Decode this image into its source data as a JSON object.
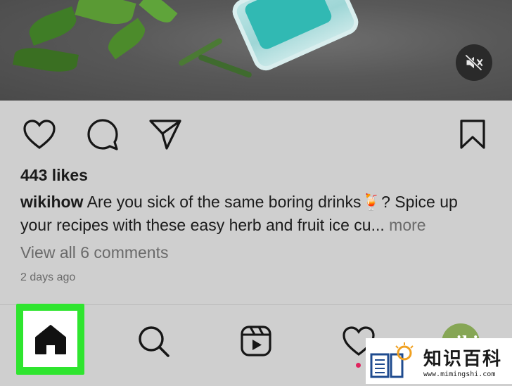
{
  "post": {
    "likes": "443 likes",
    "username": "wikihow",
    "caption_line1": " Are you sick of the same boring drinks",
    "caption_emoji": "🍹",
    "caption_line2": "? Spice up your recipes with these easy herb and fruit ice cu...",
    "more_label": " more",
    "comments_link": "View all 6 comments",
    "time_ago": "2 days ago"
  },
  "icons": {
    "mute": "speaker-muted-icon",
    "like": "heart-icon",
    "comment": "comment-bubble-icon",
    "share": "paper-plane-icon",
    "save": "bookmark-icon",
    "home": "home-icon",
    "search": "search-icon",
    "reels": "reels-icon",
    "activity": "heart-icon"
  },
  "profile": {
    "avatar_text": "wiki"
  },
  "colors": {
    "highlight": "#2fe52f",
    "notification_dot": "#e0245e"
  },
  "watermark": {
    "title": "知识百科",
    "url": "www.mimingshi.com"
  }
}
